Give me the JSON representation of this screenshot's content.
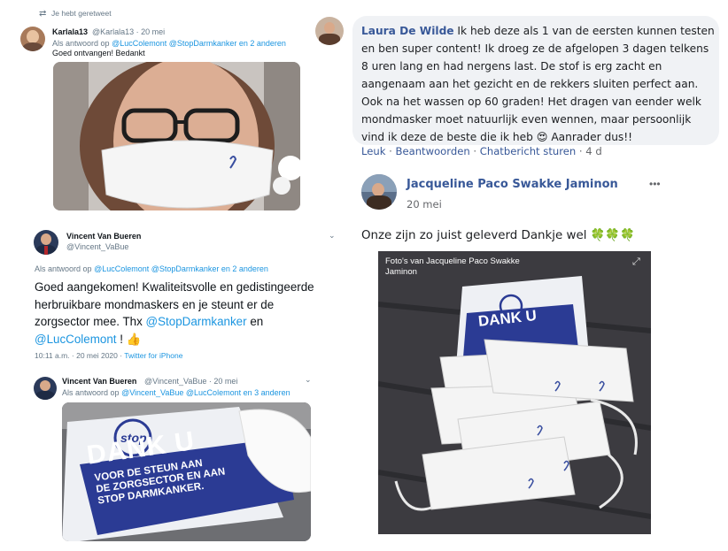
{
  "tweet1": {
    "retweet_label": "Je hebt geretweet",
    "name": "Karlala13",
    "handle_time": "@Karlala13 · 20 mei",
    "reply_prefix": "Als antwoord op",
    "reply_mentions": "@LucColemont @StopDarmkanker en 2 anderen",
    "text": "Goed ontvangen! Bedankt"
  },
  "tweet2": {
    "name": "Vincent Van Bueren",
    "handle": "@Vincent_VaBue",
    "reply_prefix": "Als antwoord op",
    "reply_mentions": "@LucColemont @StopDarmkanker en 2 anderen",
    "text_line1": "Goed aangekomen! Kwaliteitsvolle en gedistingeerde",
    "text_line2": "herbruikbare mondmaskers en je steunt er de",
    "text_line3a": "zorgsector mee. Thx ",
    "text_mention1": "@StopDarmkanker",
    "text_line3b": " en",
    "text_mention2": "@LucColemont",
    "text_line4b": " ! ",
    "thumb_emoji": "👍",
    "timestamp": "10:11 a.m. · 20 mei 2020 · ",
    "source": "Twitter for iPhone"
  },
  "tweet3": {
    "name": "Vincent Van Bueren",
    "handle_time": "@Vincent_VaBue · 20 mei",
    "reply_prefix": "Als antwoord op",
    "reply_mentions": "@Vincent_VaBue @LucColemont en 3 anderen",
    "sign_dank": "DANK U",
    "sign_line1": "VOOR DE STEUN AAN",
    "sign_line2": "DE ZORGSECTOR EN AAN",
    "sign_line3": "STOP DARMKANKER.",
    "logo_text": "stop"
  },
  "fb_comment": {
    "author": "Laura De Wilde",
    "line1": " Ik heb deze als 1 van de eersten kunnen testen",
    "line2": "en ben super content! Ik droeg ze de afgelopen 3 dagen telkens",
    "line3": "8 uren lang en had nergens last. De stof is erg zacht en",
    "line4": "aangenaam aan het gezicht en de rekkers sluiten perfect aan.",
    "line5": "Ook na het wassen op 60 graden! Het dragen van eender welk",
    "line6": "mondmasker moet natuurlijk even wennen, maar persoonlijk",
    "line7a": "vind ik deze de beste die ik heb ",
    "line7_emoji": "😍",
    "line7b": " Aanrader dus!!",
    "actions": [
      "Leuk",
      "Beantwoorden",
      "Chatbericht sturen"
    ],
    "time": "4 d"
  },
  "fb_post": {
    "author": "Jacqueline Paco Swakke Jaminon",
    "date": "20 mei",
    "more": "•••",
    "text": "Onze zijn zo juist geleverd Dankje wel ",
    "emojis": "🍀🍀🍀",
    "photo_caption_line1": "Foto's van Jacqueline Paco Swakke",
    "photo_caption_line2": "Jaminon",
    "expand_icon": "⤢",
    "sign_dank": "DANK U"
  },
  "colors": {
    "twitter_blue": "#1b95e0",
    "facebook_link": "#385898",
    "bubble_bg": "#f0f2f5",
    "sign_blue": "#2b3b94"
  }
}
